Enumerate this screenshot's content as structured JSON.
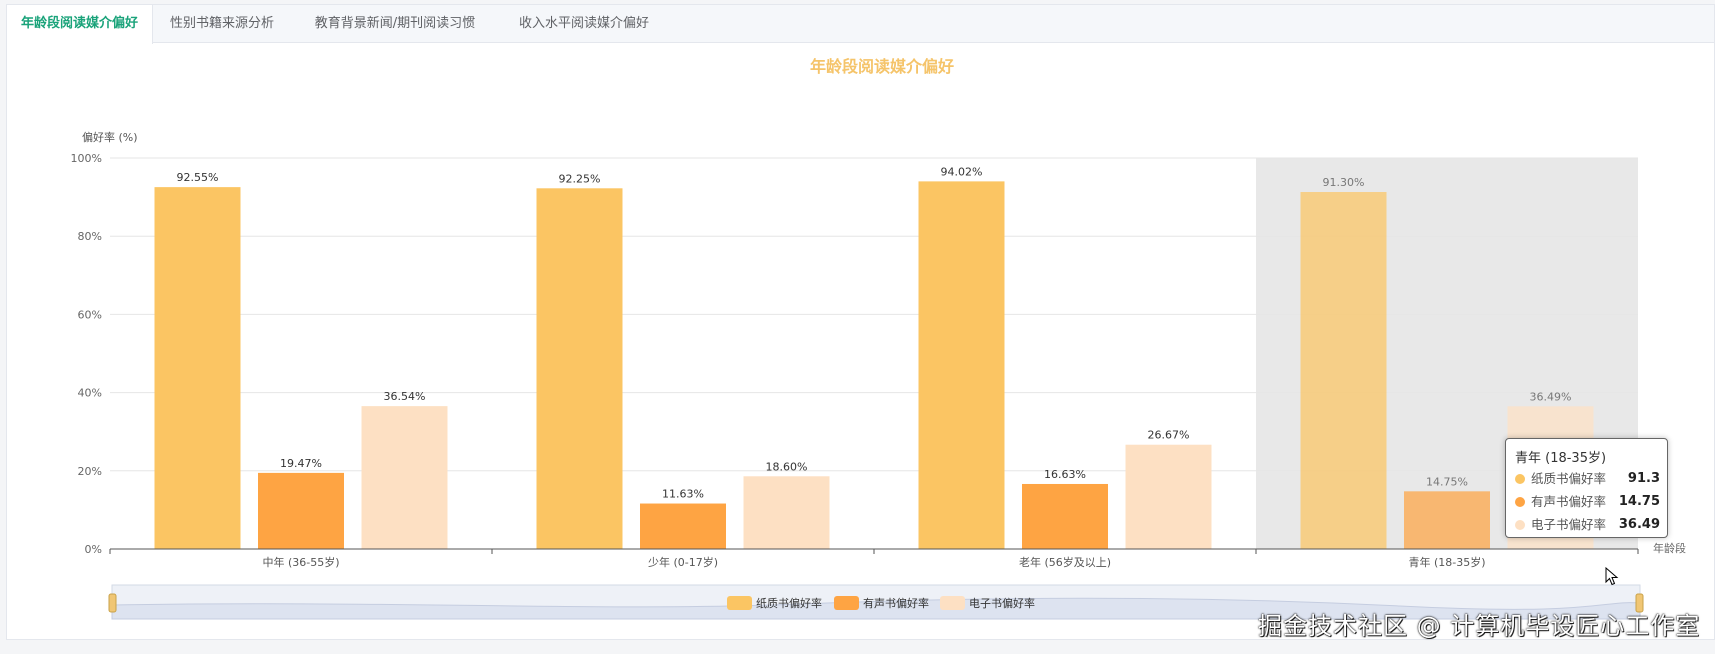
{
  "tabs": [
    {
      "label": "年龄段阅读媒介偏好",
      "active": true
    },
    {
      "label": "性别书籍来源分析",
      "active": false
    },
    {
      "label": "教育背景新闻/期刊阅读习惯",
      "active": false
    },
    {
      "label": "收入水平阅读媒介偏好",
      "active": false
    }
  ],
  "colors": {
    "accent": "#1aa37a",
    "title": "#f5c46a",
    "paper": "#fbc563",
    "audio": "#fea443",
    "ebook": "#fde0c3",
    "highlight": "#e8e8e8"
  },
  "chart_data": {
    "type": "bar",
    "title": "年龄段阅读媒介偏好",
    "ylabel": "偏好率 (%)",
    "xlabel": "年龄段",
    "ylim": [
      0,
      100
    ],
    "y_ticks": [
      "0%",
      "20%",
      "40%",
      "60%",
      "80%",
      "100%"
    ],
    "categories": [
      "中年 (36-55岁)",
      "少年 (0-17岁)",
      "老年 (56岁及以上)",
      "青年 (18-35岁)"
    ],
    "series": [
      {
        "name": "纸质书偏好率",
        "values": [
          92.55,
          92.25,
          94.02,
          91.3
        ],
        "labels": [
          "92.55%",
          "92.25%",
          "94.02%",
          "91.30%"
        ]
      },
      {
        "name": "有声书偏好率",
        "values": [
          19.47,
          11.63,
          16.63,
          14.75
        ],
        "labels": [
          "19.47%",
          "11.63%",
          "16.63%",
          "14.75%"
        ]
      },
      {
        "name": "电子书偏好率",
        "values": [
          36.54,
          18.6,
          26.67,
          36.49
        ],
        "labels": [
          "36.54%",
          "18.60%",
          "26.67%",
          "36.49%"
        ]
      }
    ],
    "highlighted_category": "青年 (18-35岁)",
    "legend_position": "bottom",
    "grid": true
  },
  "tooltip": {
    "title": "青年 (18-35岁)",
    "rows": [
      {
        "name": "纸质书偏好率",
        "value": "91.3"
      },
      {
        "name": "有声书偏好率",
        "value": "14.75"
      },
      {
        "name": "电子书偏好率",
        "value": "36.49"
      }
    ]
  },
  "watermark": "掘金技术社区 @ 计算机毕设匠心工作室"
}
